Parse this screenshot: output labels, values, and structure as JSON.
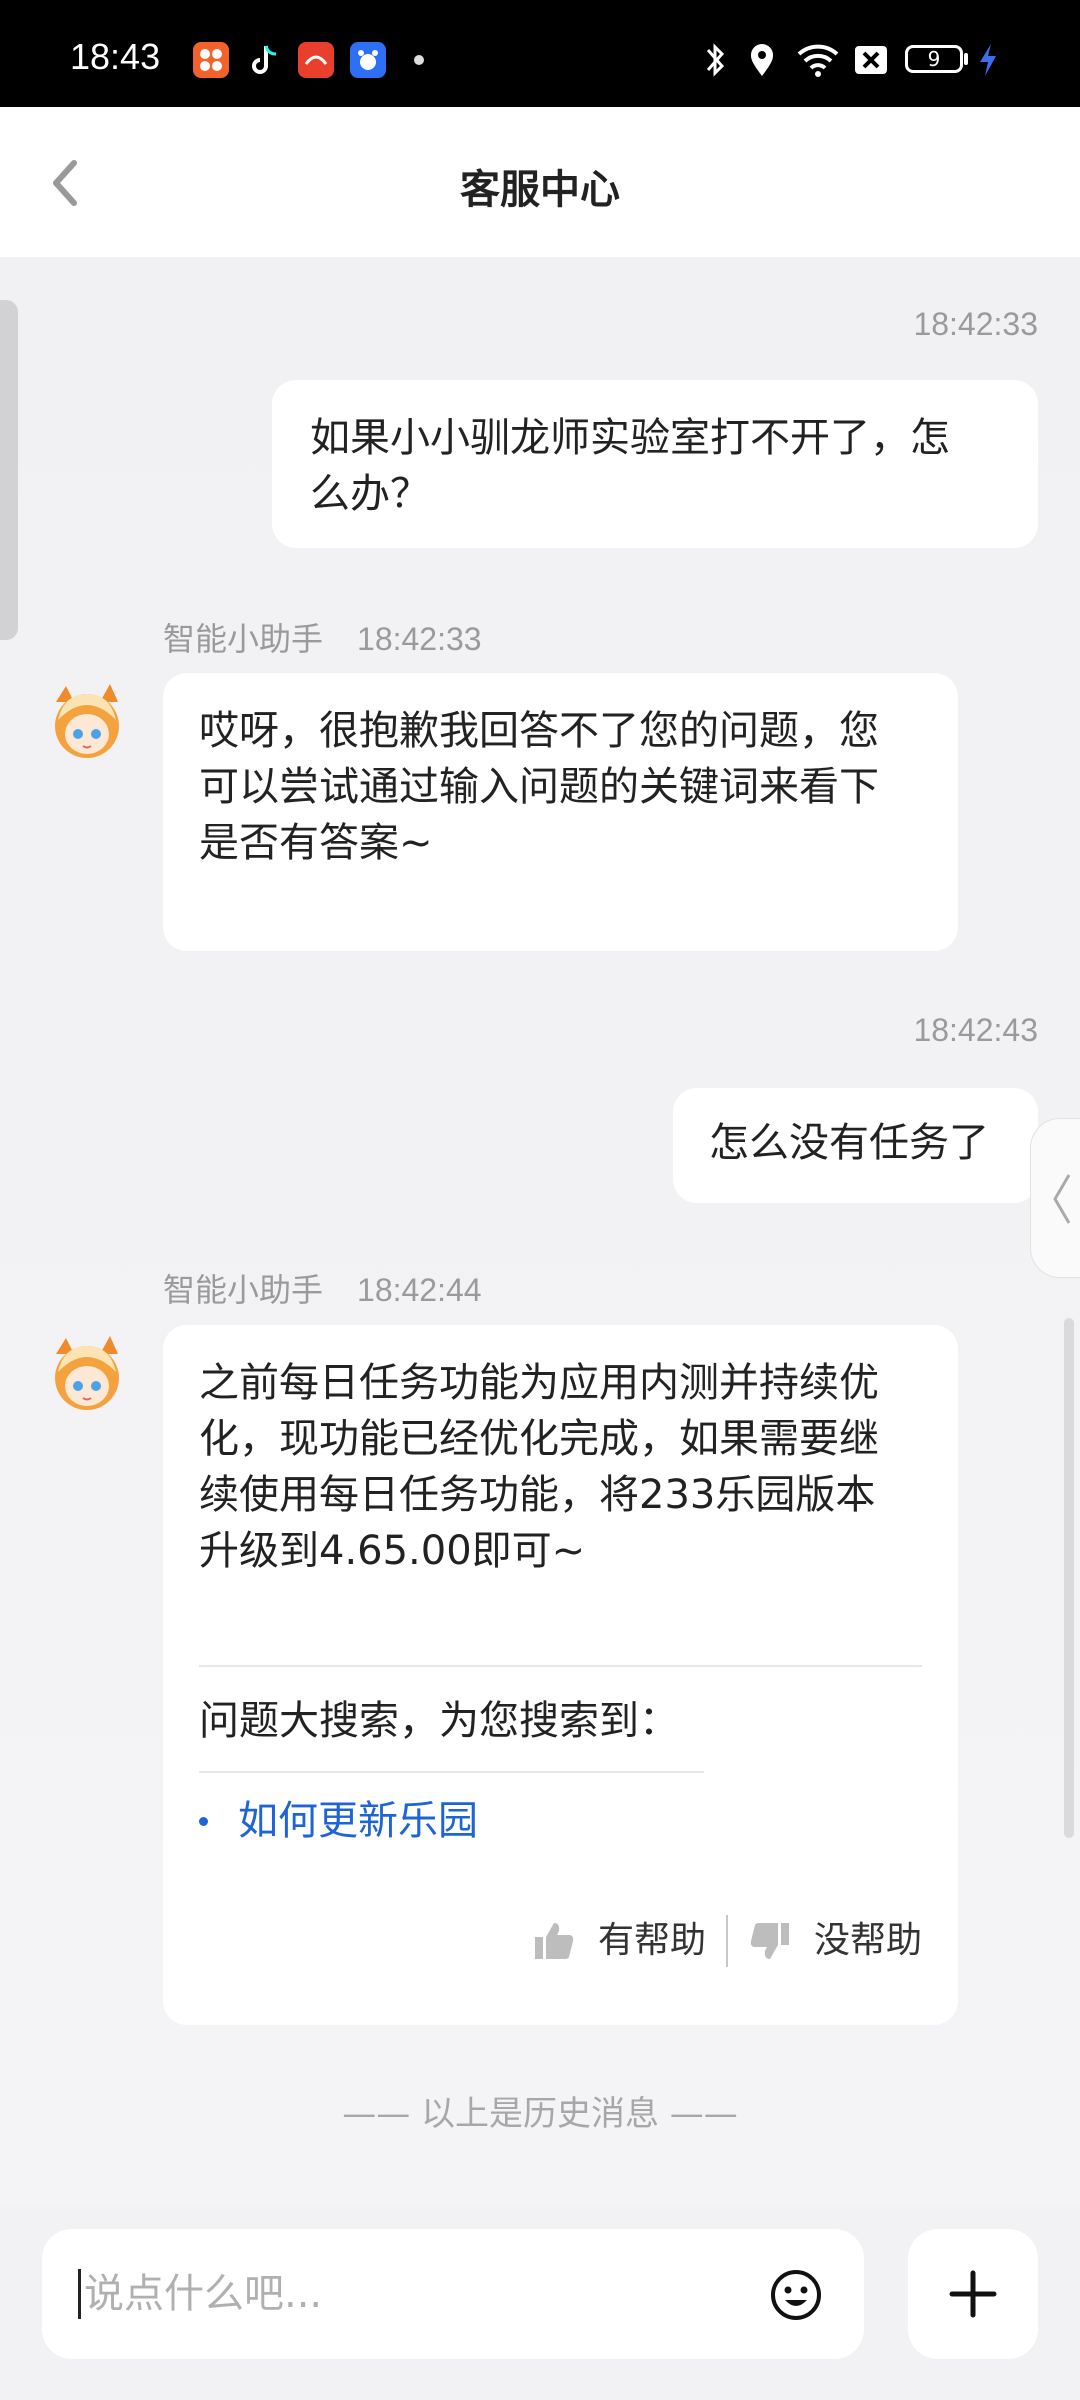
{
  "status_bar": {
    "time": "18:43",
    "battery": "9",
    "icons": [
      "app-icon-orange",
      "tiktok-icon",
      "app-icon-red",
      "baidu-icon",
      "bluetooth-icon",
      "location-icon",
      "wifi-icon",
      "no-sim-icon",
      "battery-icon",
      "charging-icon"
    ]
  },
  "header": {
    "title": "客服中心",
    "back_icon": "chevron-left-icon"
  },
  "messages": [
    {
      "sender": "user",
      "time": "18:42:33",
      "lines": [
        "如果小小驯龙师实验室打不开了，怎",
        "么办？"
      ]
    },
    {
      "sender": "bot",
      "name": "智能小助手",
      "time": "18:42:33",
      "lines": [
        "哎呀，很抱歉我回答不了您的问题，您",
        "可以尝试通过输入问题的关键词来看下",
        "是否有答案~"
      ]
    },
    {
      "sender": "user",
      "time": "18:42:43",
      "lines": [
        "怎么没有任务了"
      ]
    },
    {
      "sender": "bot",
      "name": "智能小助手",
      "time": "18:42:44",
      "lines": [
        "之前每日任务功能为应用内测并持续优",
        "化，现功能已经优化完成，如果需要继",
        "续使用每日任务功能，将233乐园版本",
        "升级到4.65.00即可~"
      ],
      "search_heading": "问题大搜索，为您搜索到：",
      "links": [
        "如何更新乐园"
      ],
      "helpful": "有帮助",
      "not_helpful": "没帮助"
    }
  ],
  "history_separator": "—— 以上是历史消息 ——",
  "input": {
    "placeholder": "说点什么吧..."
  },
  "colors": {
    "link": "#1e64d6",
    "background": "#f2f2f4",
    "bubble": "#ffffff"
  }
}
